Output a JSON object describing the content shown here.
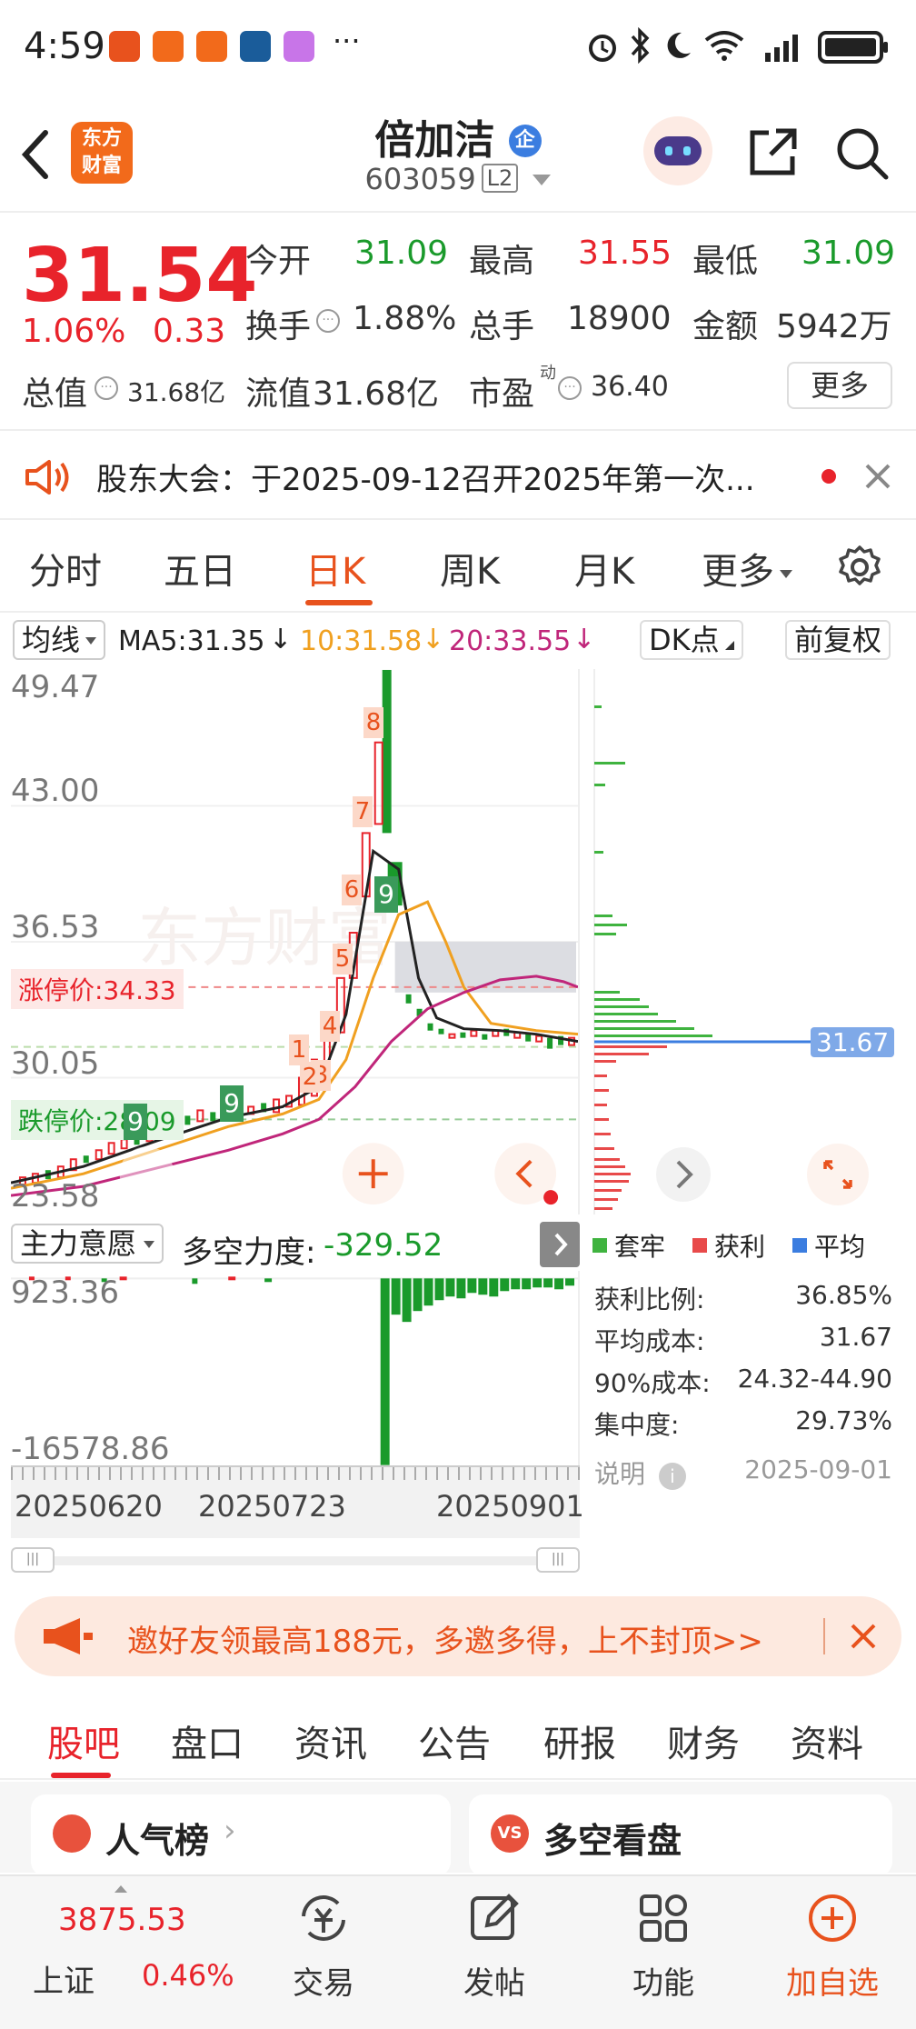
{
  "status_bar": {
    "time": "4:59",
    "dots": "···"
  },
  "header": {
    "logo_text": "东方财富",
    "stock_name": "倍加洁",
    "badge": "企",
    "code": "603059",
    "level": "L2"
  },
  "quote": {
    "price": "31.54",
    "pct": "1.06%",
    "change": "0.33",
    "open_label": "今开",
    "open": "31.09",
    "high_label": "最高",
    "high": "31.55",
    "low_label": "最低",
    "low": "31.09",
    "turnover_label": "换手",
    "turnover": "1.88%",
    "volume_label": "总手",
    "volume": "18900",
    "amount_label": "金额",
    "amount": "5942万",
    "mktcap_label": "总值",
    "mktcap": "31.68亿",
    "float_label": "流值",
    "float": "31.68亿",
    "pe_label": "市盈",
    "pe_sup": "动",
    "pe": "36.40",
    "more": "更多"
  },
  "notice": {
    "text": "股东大会：于2025-09-12召开2025年第一次..."
  },
  "k_tabs": [
    "分时",
    "五日",
    "日K",
    "周K",
    "月K",
    "更多"
  ],
  "active_k_tab": "日K",
  "ma_row": {
    "ma_selector": "均线",
    "ma5": "MA5:31.35",
    "ma10": "10:31.58",
    "ma20": "20:33.55",
    "dk": "DK点",
    "adjust": "前复权"
  },
  "chart": {
    "y_labels": [
      "49.47",
      "43.00",
      "36.53",
      "30.05",
      "23.58"
    ],
    "limit_up": "涨停价:34.33",
    "limit_down": "跌停价:28.09",
    "chip_price": "31.67",
    "watermark": "东方财富",
    "markers_up": [
      "8",
      "7",
      "6",
      "5",
      "4",
      "3",
      "2",
      "1"
    ],
    "marker_9": "9"
  },
  "indicator": {
    "selector": "主力意愿",
    "name": "多空力度:",
    "value": "-329.52",
    "top": "923.36",
    "bottom": "-16578.86"
  },
  "dates": [
    "20250620",
    "20250723",
    "20250901"
  ],
  "chip_legend": [
    {
      "label": "套牢",
      "color": "#3fb33f"
    },
    {
      "label": "获利",
      "color": "#e84a4a"
    },
    {
      "label": "平均",
      "color": "#3b7de0"
    }
  ],
  "chip_stats": [
    {
      "label": "获利比例:",
      "value": "36.85%"
    },
    {
      "label": "平均成本:",
      "value": "31.67"
    },
    {
      "label": "90%成本:",
      "value": "24.32-44.90"
    },
    {
      "label": "集中度:",
      "value": "29.73%"
    }
  ],
  "chip_note": {
    "label": "说明",
    "date": "2025-09-01"
  },
  "promo": {
    "text": "邀好友领最高188元，多邀多得，上不封顶>>"
  },
  "bottom_tabs": [
    "股吧",
    "盘口",
    "资讯",
    "公告",
    "研报",
    "财务",
    "资料"
  ],
  "active_bottom_tab": "股吧",
  "cards": [
    {
      "title": "人气榜"
    },
    {
      "title": "多空看盘"
    }
  ],
  "bottom_nav": {
    "index_value": "3875.53",
    "index_name": "上证",
    "index_pct": "0.46%",
    "items": [
      "交易",
      "发帖",
      "功能",
      "加自选"
    ]
  },
  "colors": {
    "up": "#e8232b",
    "down": "#1a9a2b",
    "accent": "#e8521d"
  }
}
